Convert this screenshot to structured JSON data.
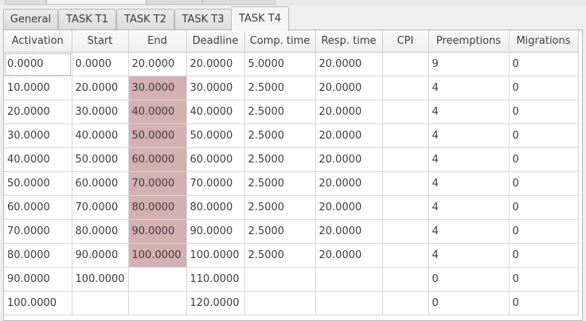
{
  "tabs": [
    {
      "label": "General",
      "active": false
    },
    {
      "label": "TASK T1",
      "active": false
    },
    {
      "label": "TASK T2",
      "active": false
    },
    {
      "label": "TASK T3",
      "active": false
    },
    {
      "label": "TASK T4",
      "active": true
    }
  ],
  "table": {
    "columns": [
      "Activation",
      "Start",
      "End",
      "Deadline",
      "Comp. time",
      "Resp. time",
      "CPI",
      "Preemptions",
      "Migrations"
    ],
    "rows": [
      {
        "cells": [
          "0.0000",
          "0.0000",
          "20.0000",
          "20.0000",
          "5.0000",
          "20.0000",
          "",
          "9",
          "0"
        ],
        "end_highlight": false
      },
      {
        "cells": [
          "10.0000",
          "20.0000",
          "30.0000",
          "30.0000",
          "2.5000",
          "20.0000",
          "",
          "4",
          "0"
        ],
        "end_highlight": true
      },
      {
        "cells": [
          "20.0000",
          "30.0000",
          "40.0000",
          "40.0000",
          "2.5000",
          "20.0000",
          "",
          "4",
          "0"
        ],
        "end_highlight": true
      },
      {
        "cells": [
          "30.0000",
          "40.0000",
          "50.0000",
          "50.0000",
          "2.5000",
          "20.0000",
          "",
          "4",
          "0"
        ],
        "end_highlight": true
      },
      {
        "cells": [
          "40.0000",
          "50.0000",
          "60.0000",
          "60.0000",
          "2.5000",
          "20.0000",
          "",
          "4",
          "0"
        ],
        "end_highlight": true
      },
      {
        "cells": [
          "50.0000",
          "60.0000",
          "70.0000",
          "70.0000",
          "2.5000",
          "20.0000",
          "",
          "4",
          "0"
        ],
        "end_highlight": true
      },
      {
        "cells": [
          "60.0000",
          "70.0000",
          "80.0000",
          "80.0000",
          "2.5000",
          "20.0000",
          "",
          "4",
          "0"
        ],
        "end_highlight": true
      },
      {
        "cells": [
          "70.0000",
          "80.0000",
          "90.0000",
          "90.0000",
          "2.5000",
          "20.0000",
          "",
          "4",
          "0"
        ],
        "end_highlight": true
      },
      {
        "cells": [
          "80.0000",
          "90.0000",
          "100.0000",
          "100.0000",
          "2.5000",
          "20.0000",
          "",
          "4",
          "0"
        ],
        "end_highlight": true
      },
      {
        "cells": [
          "90.0000",
          "100.0000",
          "",
          "110.0000",
          "",
          "",
          "",
          "0",
          "0"
        ],
        "end_highlight": false
      },
      {
        "cells": [
          "100.0000",
          "",
          "",
          "120.0000",
          "",
          "",
          "",
          "0",
          "0"
        ],
        "end_highlight": false
      }
    ]
  },
  "colors": {
    "missed_deadline_highlight": "#d4b0b0",
    "header_background": "#f4f4f4",
    "grid_line": "#d8d8d8"
  }
}
